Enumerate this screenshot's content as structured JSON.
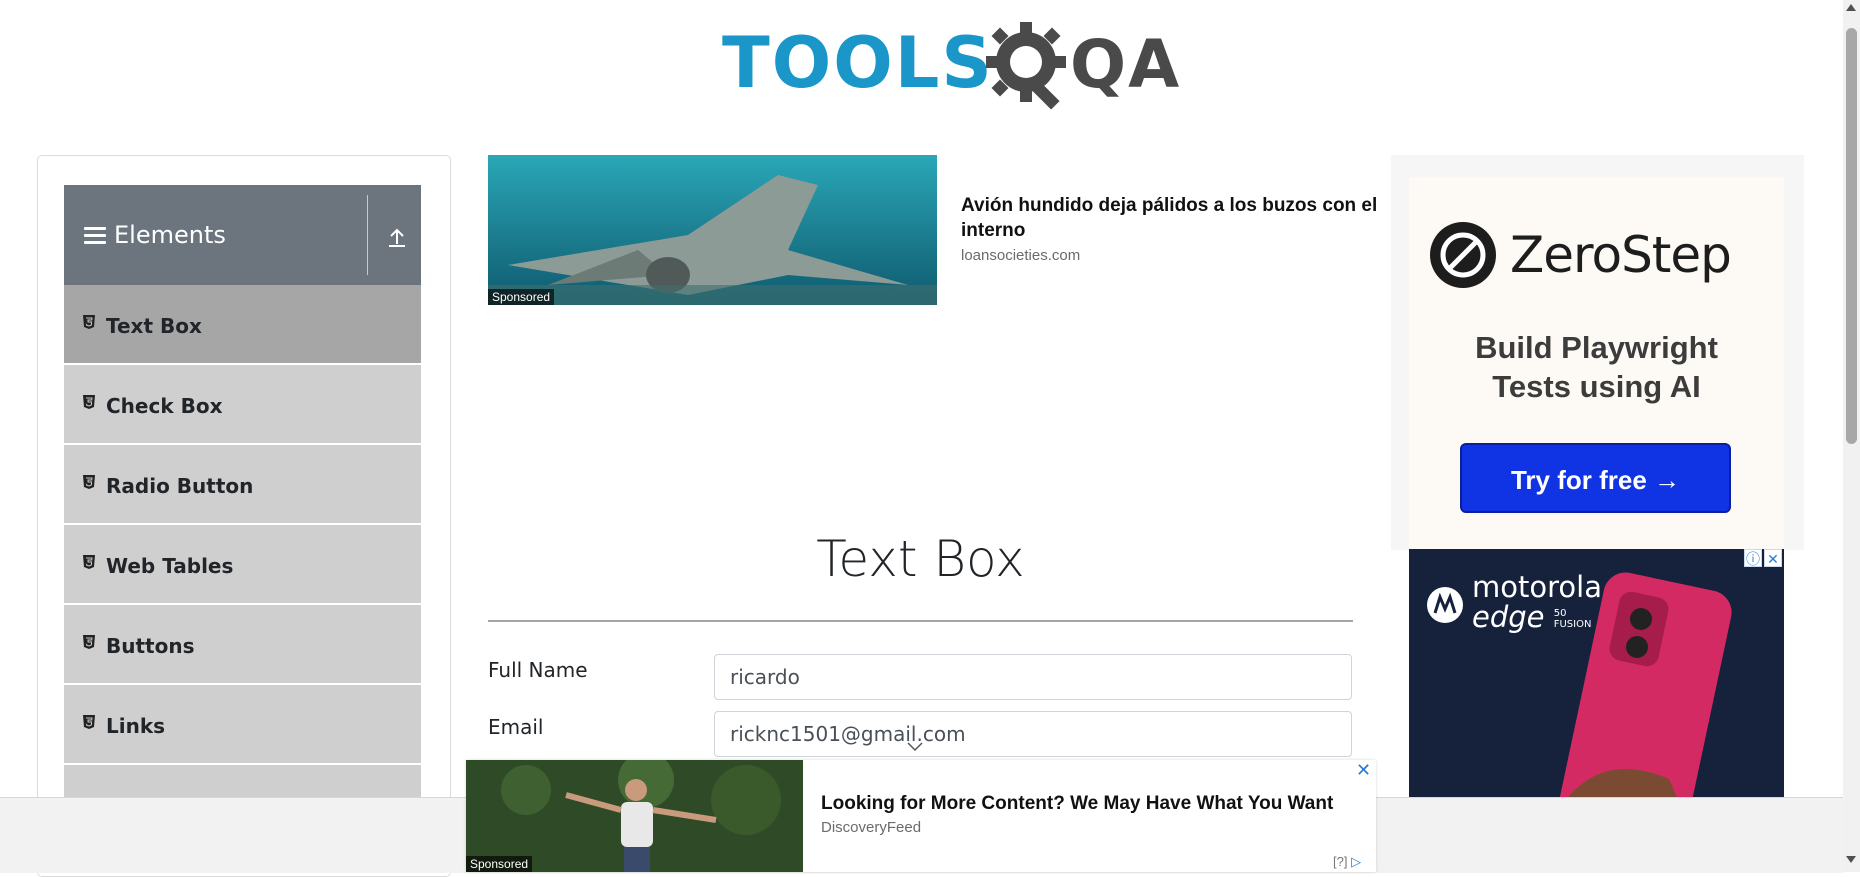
{
  "logo": {
    "brand_tools": "TOOLS",
    "brand_qa": "QA"
  },
  "sidebar": {
    "group_title": "Elements",
    "items": [
      {
        "label": "Text Box",
        "active": true
      },
      {
        "label": "Check Box",
        "active": false
      },
      {
        "label": "Radio Button",
        "active": false
      },
      {
        "label": "Web Tables",
        "active": false
      },
      {
        "label": "Buttons",
        "active": false
      },
      {
        "label": "Links",
        "active": false
      }
    ]
  },
  "ad_top": {
    "badge": "Sponsored",
    "title_line1": "Avión hundido deja pálidos a los buzos con el",
    "title_line2": "interno",
    "source": "loansocieties.com"
  },
  "ad_zerostep": {
    "brand": "ZeroStep",
    "tagline_line1": "Build Playwright",
    "tagline_line2": "Tests using AI",
    "cta": "Try for free →",
    "accent": "#1034e3"
  },
  "ad_motorola": {
    "brand_line1": "motorola",
    "brand_line2": "edge",
    "model_num": "50",
    "model_suffix": "FUSION"
  },
  "main": {
    "heading": "Text Box",
    "fields": {
      "full_name_label": "Full Name",
      "full_name_value": "ricardo",
      "email_label": "Email",
      "email_value": "ricknc1501@gmail.com"
    }
  },
  "ad_bottom": {
    "badge": "Sponsored",
    "title": "Looking for More Content? We May Have What You Want",
    "source": "DiscoveryFeed",
    "help": "[?]",
    "close": "✕"
  }
}
